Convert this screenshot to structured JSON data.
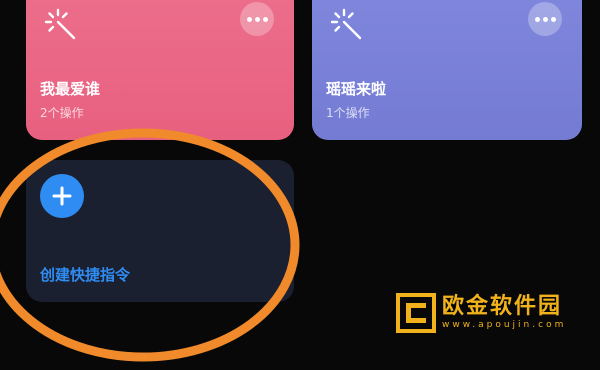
{
  "cards": [
    {
      "title": "我最爱谁",
      "subtitle": "2个操作",
      "color": "#e8607f",
      "icon": "magic-wand-icon",
      "menu_icon": "more-icon"
    },
    {
      "title": "瑶瑶来啦",
      "subtitle": "1个操作",
      "color": "#747bd3",
      "icon": "magic-wand-icon",
      "menu_icon": "more-icon"
    }
  ],
  "create_card": {
    "label": "创建快捷指令",
    "icon": "plus-icon",
    "accent": "#2f8cf3"
  },
  "annotation": {
    "color": "#f08a2a"
  },
  "watermark": {
    "text": "欧金软件园",
    "url": "www.apoujin.com",
    "color": "#f2b21b"
  }
}
